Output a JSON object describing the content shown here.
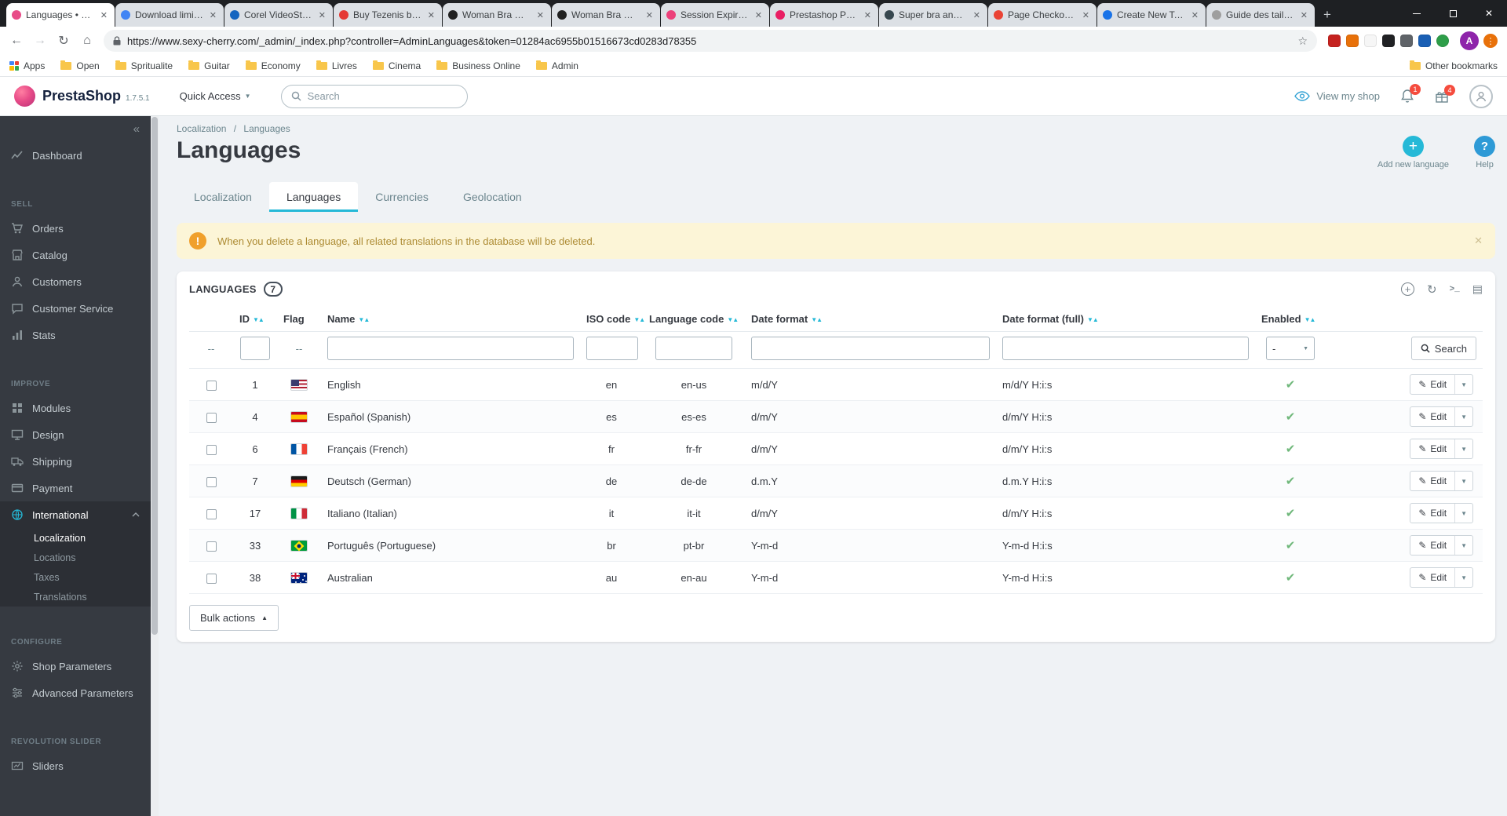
{
  "browser": {
    "tabs": [
      {
        "title": "Languages • S…",
        "favicon": "#e84c88",
        "active": true
      },
      {
        "title": "Download limi…",
        "favicon": "#4285f4"
      },
      {
        "title": "Corel VideoSt…",
        "favicon": "#1565c0"
      },
      {
        "title": "Buy Tezenis b…",
        "favicon": "#e53935"
      },
      {
        "title": "Woman Bra G…",
        "favicon": "#212121"
      },
      {
        "title": "Woman Bra G…",
        "favicon": "#212121"
      },
      {
        "title": "Session Expira…",
        "favicon": "#ec407a"
      },
      {
        "title": "Prestashop Pr…",
        "favicon": "#e91e63"
      },
      {
        "title": "Super bra and…",
        "favicon": "#37474f"
      },
      {
        "title": "Page Checkou…",
        "favicon": "#ea4335"
      },
      {
        "title": "Create New To…",
        "favicon": "#1a73e8"
      },
      {
        "title": "Guide des tail…",
        "favicon": "#9e9e9e"
      }
    ],
    "url": "https://www.sexy-cherry.com/_admin/_index.php?controller=AdminLanguages&token=01284ac6955b01516673cd0283d78355",
    "extensions": [
      "#c5221f",
      "#e8710a",
      "#f6f6f6",
      "#202124",
      "#5f6368",
      "#1a5fb4",
      "#2e9e49"
    ],
    "profile_initial": "A",
    "bookmarks": [
      {
        "label": "Apps",
        "type": "apps"
      },
      {
        "label": "Open",
        "type": "folder"
      },
      {
        "label": "Spritualite",
        "type": "folder"
      },
      {
        "label": "Guitar",
        "type": "folder"
      },
      {
        "label": "Economy",
        "type": "folder"
      },
      {
        "label": "Livres",
        "type": "folder"
      },
      {
        "label": "Cinema",
        "type": "folder"
      },
      {
        "label": "Business Online",
        "type": "folder"
      },
      {
        "label": "Admin",
        "type": "folder"
      }
    ],
    "other_bookmarks": "Other bookmarks"
  },
  "header": {
    "brand": "PrestaShop",
    "version": "1.7.5.1",
    "quick_access": "Quick Access",
    "search_placeholder": "Search",
    "view_my_shop": "View my shop",
    "bell_badge": "1",
    "gift_badge": "4"
  },
  "sidebar": {
    "sections": [
      {
        "title": "",
        "items": [
          {
            "label": "Dashboard",
            "icon": "trend"
          }
        ]
      },
      {
        "title": "SELL",
        "items": [
          {
            "label": "Orders",
            "icon": "cart"
          },
          {
            "label": "Catalog",
            "icon": "store"
          },
          {
            "label": "Customers",
            "icon": "person"
          },
          {
            "label": "Customer Service",
            "icon": "chat"
          },
          {
            "label": "Stats",
            "icon": "stats"
          }
        ]
      },
      {
        "title": "IMPROVE",
        "items": [
          {
            "label": "Modules",
            "icon": "modules"
          },
          {
            "label": "Design",
            "icon": "monitor"
          },
          {
            "label": "Shipping",
            "icon": "truck"
          },
          {
            "label": "Payment",
            "icon": "card"
          },
          {
            "label": "International",
            "icon": "globe",
            "active": true,
            "expanded": true,
            "children": [
              {
                "label": "Localization",
                "active": true
              },
              {
                "label": "Locations"
              },
              {
                "label": "Taxes"
              },
              {
                "label": "Translations"
              }
            ]
          }
        ]
      },
      {
        "title": "CONFIGURE",
        "items": [
          {
            "label": "Shop Parameters",
            "icon": "gear"
          },
          {
            "label": "Advanced Parameters",
            "icon": "settings"
          }
        ]
      },
      {
        "title": "REVOLUTION SLIDER",
        "items": [
          {
            "label": "Sliders",
            "icon": "sliders"
          }
        ]
      }
    ]
  },
  "page": {
    "breadcrumb": [
      "Localization",
      "Languages"
    ],
    "title": "Languages",
    "add_new": "Add new language",
    "help": "Help",
    "tabs": [
      {
        "label": "Localization"
      },
      {
        "label": "Languages",
        "active": true
      },
      {
        "label": "Currencies"
      },
      {
        "label": "Geolocation"
      }
    ],
    "alert": "When you delete a language, all related translations in the database will be deleted."
  },
  "panel": {
    "title": "LANGUAGES",
    "count": "7",
    "columns": {
      "id": "ID",
      "flag": "Flag",
      "name": "Name",
      "iso": "ISO code",
      "code": "Language code",
      "date": "Date format",
      "date_full": "Date format (full)",
      "enabled": "Enabled"
    },
    "filter_dash": "--",
    "enabled_filter": "-",
    "search_label": "Search",
    "edit_label": "Edit",
    "bulk_actions": "Bulk actions",
    "rows": [
      {
        "id": "1",
        "flag": "us",
        "name": "English",
        "iso": "en",
        "code": "en-us",
        "date": "m/d/Y",
        "date_full": "m/d/Y H:i:s",
        "enabled": true
      },
      {
        "id": "4",
        "flag": "es",
        "name": "Español (Spanish)",
        "iso": "es",
        "code": "es-es",
        "date": "d/m/Y",
        "date_full": "d/m/Y H:i:s",
        "enabled": true
      },
      {
        "id": "6",
        "flag": "fr",
        "name": "Français (French)",
        "iso": "fr",
        "code": "fr-fr",
        "date": "d/m/Y",
        "date_full": "d/m/Y H:i:s",
        "enabled": true
      },
      {
        "id": "7",
        "flag": "de",
        "name": "Deutsch (German)",
        "iso": "de",
        "code": "de-de",
        "date": "d.m.Y",
        "date_full": "d.m.Y H:i:s",
        "enabled": true
      },
      {
        "id": "17",
        "flag": "it",
        "name": "Italiano (Italian)",
        "iso": "it",
        "code": "it-it",
        "date": "d/m/Y",
        "date_full": "d/m/Y H:i:s",
        "enabled": true
      },
      {
        "id": "33",
        "flag": "br",
        "name": "Português (Portuguese)",
        "iso": "br",
        "code": "pt-br",
        "date": "Y-m-d",
        "date_full": "Y-m-d H:i:s",
        "enabled": true
      },
      {
        "id": "38",
        "flag": "au",
        "name": "Australian",
        "iso": "au",
        "code": "en-au",
        "date": "Y-m-d",
        "date_full": "Y-m-d H:i:s",
        "enabled": true
      }
    ]
  }
}
